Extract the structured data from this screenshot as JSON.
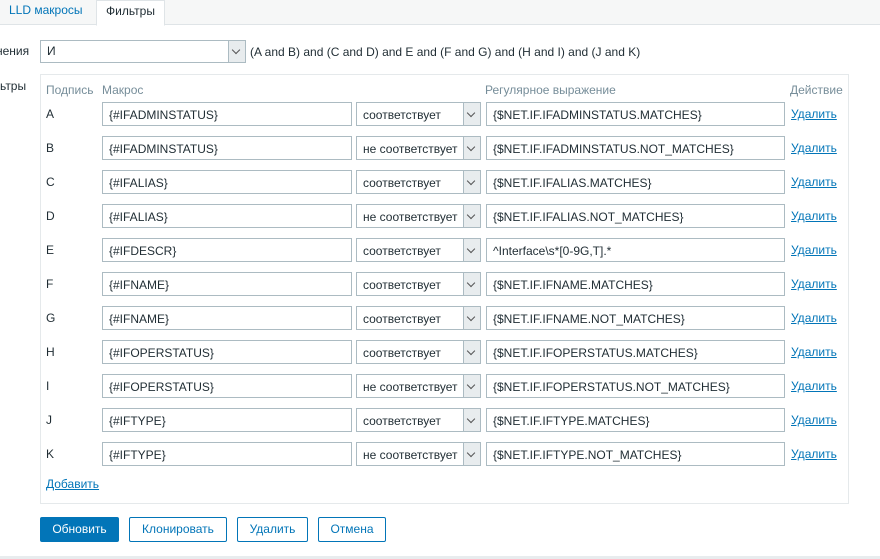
{
  "tabs": {
    "lld_macros": "LLD макросы",
    "filters": "Фильтры"
  },
  "form": {
    "calc_label": "нения",
    "filters_label": "ьтры",
    "calc_type": "И",
    "calc_formula": "(A and B) and (C and D) and E and (F and G) and (H and I) and (J and K)"
  },
  "table": {
    "headers": {
      "label": "Подпись",
      "macro": "Макрос",
      "regex": "Регулярное выражение",
      "action": "Действие"
    },
    "rows": [
      {
        "label": "A",
        "macro": "{#IFADMINSTATUS}",
        "operator": "соответствует",
        "regex": "{$NET.IF.IFADMINSTATUS.MATCHES}",
        "remove": "Удалить"
      },
      {
        "label": "B",
        "macro": "{#IFADMINSTATUS}",
        "operator": "не соответствует",
        "regex": "{$NET.IF.IFADMINSTATUS.NOT_MATCHES}",
        "remove": "Удалить"
      },
      {
        "label": "C",
        "macro": "{#IFALIAS}",
        "operator": "соответствует",
        "regex": "{$NET.IF.IFALIAS.MATCHES}",
        "remove": "Удалить"
      },
      {
        "label": "D",
        "macro": "{#IFALIAS}",
        "operator": "не соответствует",
        "regex": "{$NET.IF.IFALIAS.NOT_MATCHES}",
        "remove": "Удалить"
      },
      {
        "label": "E",
        "macro": "{#IFDESCR}",
        "operator": "соответствует",
        "regex": "^Interface\\s*[0-9G,T].*",
        "remove": "Удалить"
      },
      {
        "label": "F",
        "macro": "{#IFNAME}",
        "operator": "соответствует",
        "regex": "{$NET.IF.IFNAME.MATCHES}",
        "remove": "Удалить"
      },
      {
        "label": "G",
        "macro": "{#IFNAME}",
        "operator": "соответствует",
        "regex": "{$NET.IF.IFNAME.NOT_MATCHES}",
        "remove": "Удалить"
      },
      {
        "label": "H",
        "macro": "{#IFOPERSTATUS}",
        "operator": "соответствует",
        "regex": "{$NET.IF.IFOPERSTATUS.MATCHES}",
        "remove": "Удалить"
      },
      {
        "label": "I",
        "macro": "{#IFOPERSTATUS}",
        "operator": "не соответствует",
        "regex": "{$NET.IF.IFOPERSTATUS.NOT_MATCHES}",
        "remove": "Удалить"
      },
      {
        "label": "J",
        "macro": "{#IFTYPE}",
        "operator": "соответствует",
        "regex": "{$NET.IF.IFTYPE.MATCHES}",
        "remove": "Удалить"
      },
      {
        "label": "K",
        "macro": "{#IFTYPE}",
        "operator": "не соответствует",
        "regex": "{$NET.IF.IFTYPE.NOT_MATCHES}",
        "remove": "Удалить"
      }
    ],
    "add_link": "Добавить"
  },
  "buttons": {
    "update": "Обновить",
    "clone": "Клонировать",
    "delete": "Удалить",
    "cancel": "Отмена"
  },
  "colors": {
    "accent": "#0275b8",
    "border": "#acbbc2",
    "header_text": "#768d99"
  }
}
